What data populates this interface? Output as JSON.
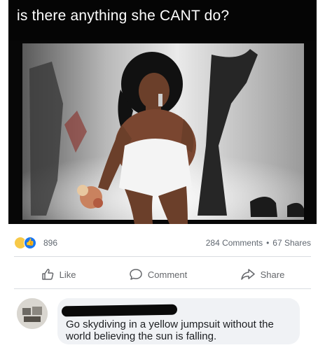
{
  "post": {
    "caption": "is there anything she CANT do?"
  },
  "reactions": {
    "count": "896",
    "icons": [
      "haha-icon",
      "like-icon"
    ]
  },
  "stats": {
    "comments": "284 Comments",
    "separator": "•",
    "shares": "67 Shares"
  },
  "actions": {
    "like_label": "Like",
    "comment_label": "Comment",
    "share_label": "Share"
  },
  "comment": {
    "text": "Go skydiving in a yellow jumpsuit without the world believing the sun is falling."
  },
  "colors": {
    "like_blue": "#1877f2",
    "haha_yellow": "#f7c948",
    "muted_text": "#606770",
    "bubble_bg": "#f0f2f5"
  }
}
